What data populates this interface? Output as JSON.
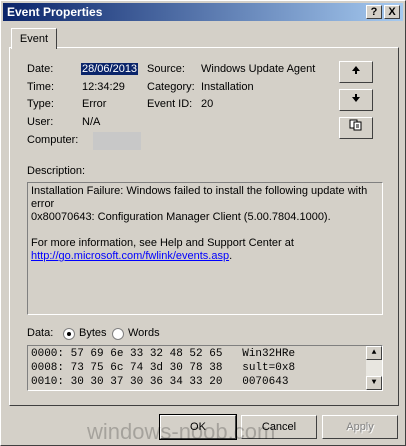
{
  "window": {
    "title": "Event Properties",
    "help_button": "?",
    "close_button": "X"
  },
  "tabs": [
    {
      "label": "Event"
    }
  ],
  "details": {
    "date_label": "Date:",
    "date_value": "28/06/2013",
    "time_label": "Time:",
    "time_value": "12:34:29",
    "type_label": "Type:",
    "type_value": "Error",
    "user_label": "User:",
    "user_value": "N/A",
    "computer_label": "Computer:",
    "source_label": "Source:",
    "source_value": "Windows Update Agent",
    "category_label": "Category:",
    "category_value": "Installation",
    "eventid_label": "Event ID:",
    "eventid_value": "20"
  },
  "nav": {
    "up_icon": "arrow-up-icon",
    "down_icon": "arrow-down-icon",
    "copy_icon": "copy-icon"
  },
  "description": {
    "label": "Description:",
    "line1": "Installation Failure: Windows failed to install the following update with error",
    "line2": "0x80070643: Configuration Manager Client (5.00.7804.1000).",
    "line3": "For more information, see Help and Support Center at",
    "link": "http://go.microsoft.com/fwlink/events.asp",
    "link_suffix": "."
  },
  "data": {
    "label": "Data:",
    "bytes_label": "Bytes",
    "words_label": "Words",
    "selected": "Bytes",
    "rows": [
      "0000: 57 69 6e 33 32 48 52 65   Win32HRe",
      "0008: 73 75 6c 74 3d 30 78 38   sult=0x8",
      "0010: 30 30 37 30 36 34 33 20   0070643 "
    ]
  },
  "buttons": {
    "ok": "OK",
    "cancel": "Cancel",
    "apply": "Apply"
  },
  "watermark": "windows-noob.com"
}
